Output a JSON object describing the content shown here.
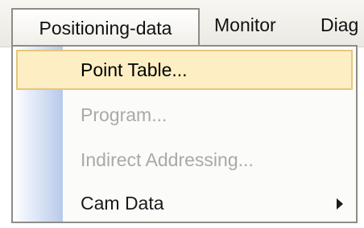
{
  "menubar": {
    "items": [
      {
        "label": "Positioning-data"
      },
      {
        "label": "Monitor"
      },
      {
        "label": "Diag"
      }
    ]
  },
  "dropdown": {
    "items": [
      {
        "label": "Point Table...",
        "state": "highlighted"
      },
      {
        "label": "Program...",
        "state": "disabled"
      },
      {
        "label": "Indirect Addressing...",
        "state": "disabled"
      },
      {
        "label": "Cam Data",
        "state": "enabled",
        "submenu": true
      }
    ]
  },
  "colors": {
    "highlight_bg": "#fdefc3",
    "highlight_border": "#e6c77a",
    "disabled_text": "#a9a9a6",
    "icon_column_blue": "#b7c9ea"
  },
  "icons": {
    "submenu": "chevron-right-icon"
  }
}
